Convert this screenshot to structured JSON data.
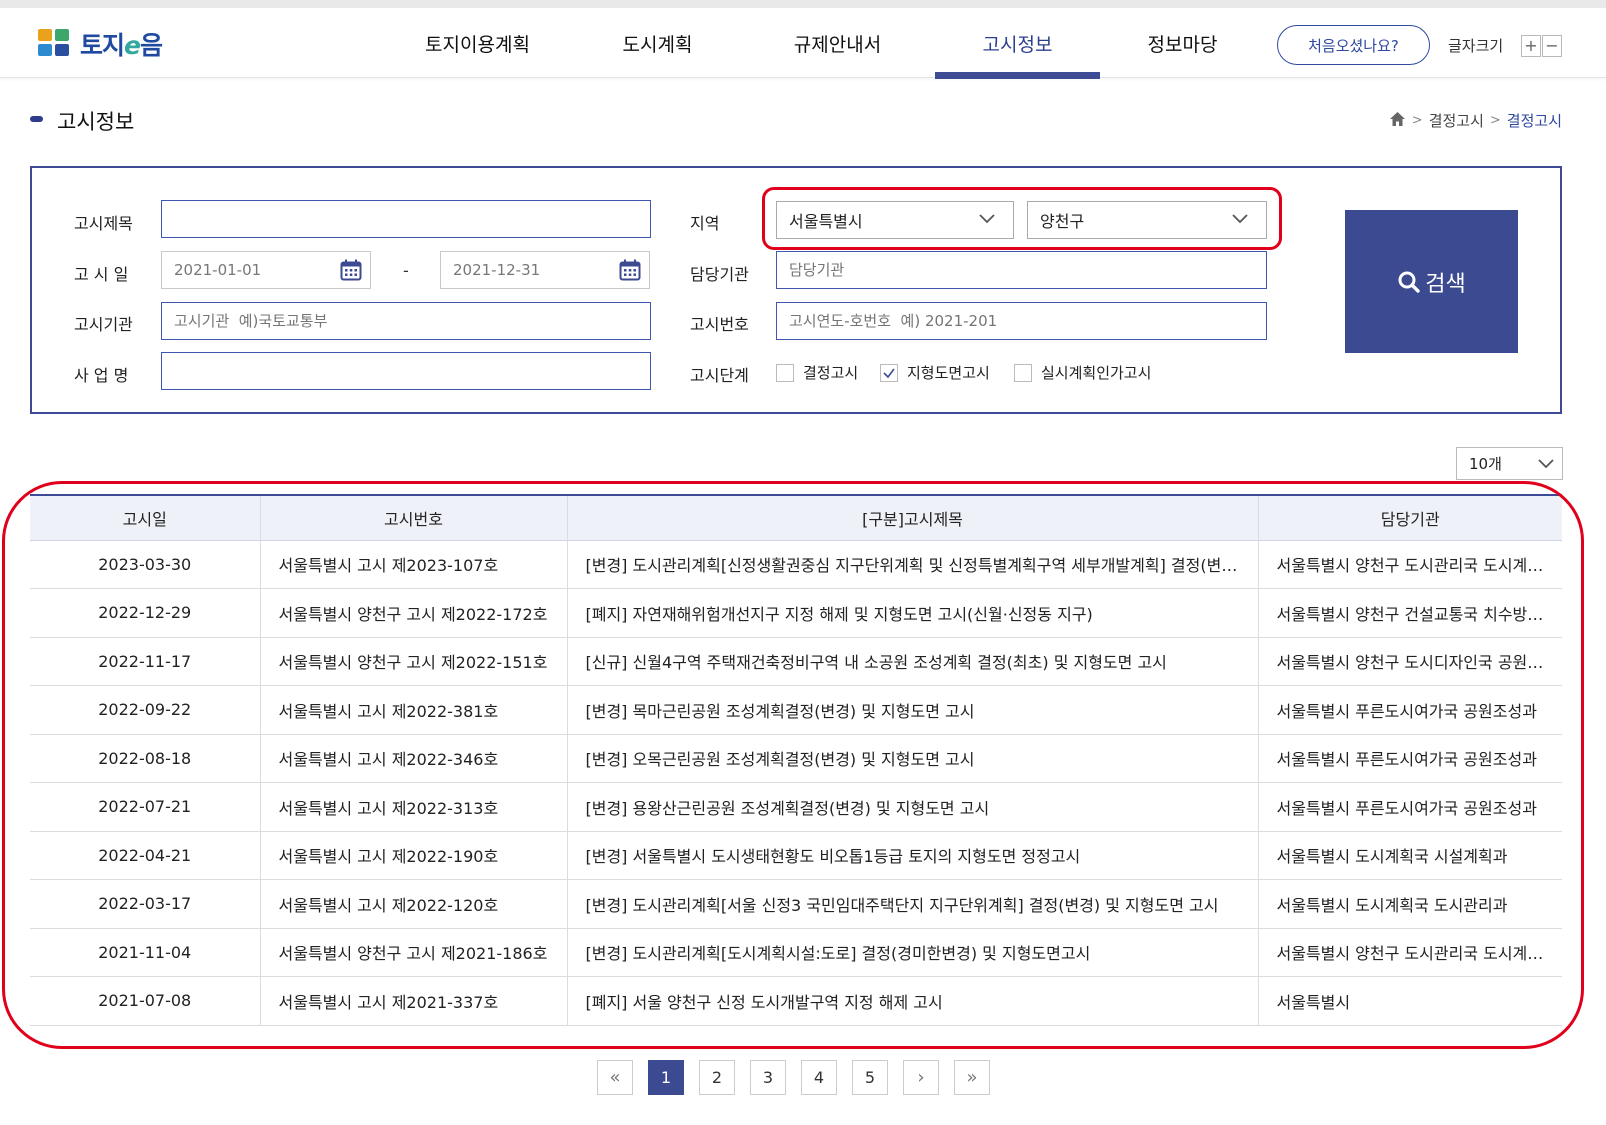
{
  "header": {
    "logo_text_a": "토지",
    "logo_text_e": "e",
    "logo_text_b": "음",
    "nav": [
      {
        "label": "토지이용계획"
      },
      {
        "label": "도시계획"
      },
      {
        "label": "규제안내서"
      },
      {
        "label": "고시정보",
        "active": true
      },
      {
        "label": "정보마당"
      }
    ],
    "first_visit_label": "처음오셨나요?",
    "font_size_label": "글자크기",
    "font_plus": "+",
    "font_minus": "−"
  },
  "page": {
    "title": "고시정보",
    "breadcrumb": [
      "결정고시",
      "결정고시"
    ]
  },
  "search": {
    "title_label": "고시제목",
    "title_value": "",
    "date_label": "고 시 일",
    "date_from": "2021-01-01",
    "date_sep": "-",
    "date_to": "2021-12-31",
    "agency_label": "고시기관",
    "agency_placeholder": "고시기관  예)국토교통부",
    "project_label": "사 업 명",
    "project_value": "",
    "region_label": "지역",
    "region_sido": "서울특별시",
    "region_sgg": "양천구",
    "dept_label": "담당기관",
    "dept_placeholder": "담당기관",
    "number_label": "고시번호",
    "number_placeholder": "고시연도-호번호  예) 2021-201",
    "stage_label": "고시단계",
    "stages": [
      {
        "label": "결정고시",
        "checked": false
      },
      {
        "label": "지형도면고시",
        "checked": true
      },
      {
        "label": "실시계획인가고시",
        "checked": false
      }
    ],
    "search_button": "검색"
  },
  "page_size": "10개",
  "table": {
    "columns": [
      "고시일",
      "고시번호",
      "[구분]고시제목",
      "담당기관"
    ],
    "rows": [
      {
        "date": "2023-03-30",
        "no": "서울특별시 고시 제2023-107호",
        "title": "[변경] 도시관리계획[신정생활권중심 지구단위계획 및 신정특별계획구역 세부개발계획] 결정(변경) 및 지형도면 고시",
        "dept": "서울특별시 양천구 도시관리국 도시계획과"
      },
      {
        "date": "2022-12-29",
        "no": "서울특별시 양천구 고시 제2022-172호",
        "title": "[폐지] 자연재해위험개선지구 지정 해제 및 지형도면 고시(신월·신정동 지구)",
        "dept": "서울특별시 양천구 건설교통국 치수방재과"
      },
      {
        "date": "2022-11-17",
        "no": "서울특별시 양천구 고시 제2022-151호",
        "title": "[신규] 신월4구역 주택재건축정비구역 내 소공원 조성계획 결정(최초) 및 지형도면 고시",
        "dept": "서울특별시 양천구 도시디자인국 공원녹지과"
      },
      {
        "date": "2022-09-22",
        "no": "서울특별시 고시 제2022-381호",
        "title": "[변경] 목마근린공원 조성계획결정(변경) 및 지형도면 고시",
        "dept": "서울특별시 푸른도시여가국 공원조성과"
      },
      {
        "date": "2022-08-18",
        "no": "서울특별시 고시 제2022-346호",
        "title": "[변경] 오목근린공원 조성계획결정(변경) 및 지형도면 고시",
        "dept": "서울특별시 푸른도시여가국 공원조성과"
      },
      {
        "date": "2022-07-21",
        "no": "서울특별시 고시 제2022-313호",
        "title": "[변경] 용왕산근린공원 조성계획결정(변경) 및 지형도면 고시",
        "dept": "서울특별시 푸른도시여가국 공원조성과"
      },
      {
        "date": "2022-04-21",
        "no": "서울특별시 고시 제2022-190호",
        "title": "[변경] 서울특별시 도시생태현황도 비오톱1등급 토지의 지형도면 정정고시",
        "dept": "서울특별시 도시계획국 시설계획과"
      },
      {
        "date": "2022-03-17",
        "no": "서울특별시 고시 제2022-120호",
        "title": "[변경] 도시관리계획[서울 신정3 국민임대주택단지 지구단위계획] 결정(변경) 및 지형도면 고시",
        "dept": "서울특별시 도시계획국 도시관리과"
      },
      {
        "date": "2021-11-04",
        "no": "서울특별시 양천구 고시 제2021-186호",
        "title": "[변경] 도시관리계획[도시계획시설:도로] 결정(경미한변경) 및 지형도면고시",
        "dept": "서울특별시 양천구 도시관리국 도시계획과"
      },
      {
        "date": "2021-07-08",
        "no": "서울특별시 고시 제2021-337호",
        "title": "[폐지] 서울 양천구 신정 도시개발구역 지정 해제 고시",
        "dept": "서울특별시"
      }
    ]
  },
  "pagination": {
    "first": "«",
    "pages": [
      "1",
      "2",
      "3",
      "4",
      "5"
    ],
    "current": "1",
    "next": "›",
    "last": "»"
  },
  "colors": {
    "brand": "#3c4a91",
    "link": "#2f4aa0",
    "highlight": "#e0001b"
  }
}
